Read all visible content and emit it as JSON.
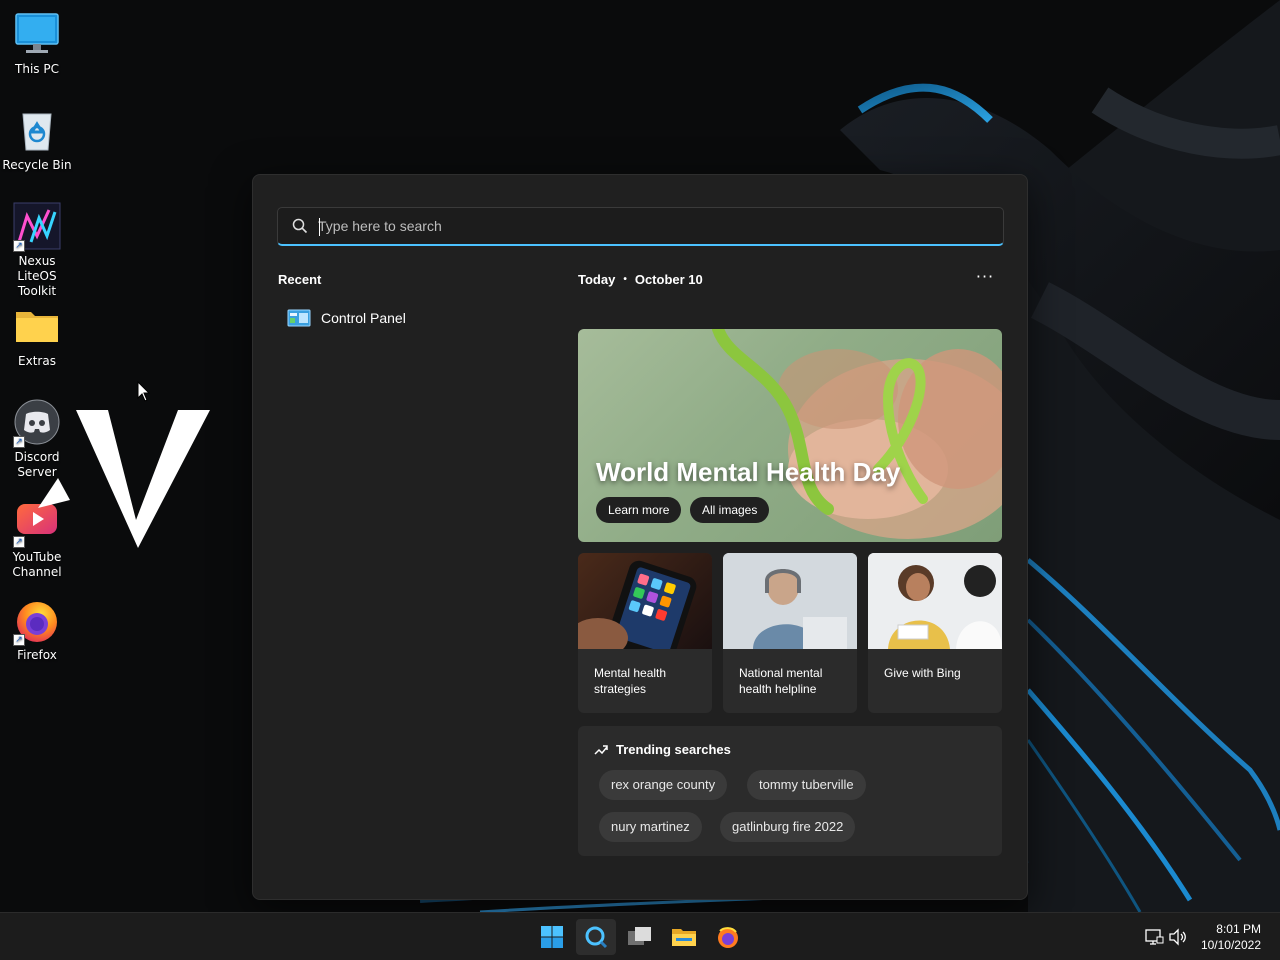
{
  "desktop": {
    "icons": [
      {
        "label": "This PC",
        "icon": "monitor-icon"
      },
      {
        "label": "Recycle Bin",
        "icon": "recycle-bin-icon"
      },
      {
        "label": "Nexus LiteOS Toolkit",
        "icon": "nexus-icon"
      },
      {
        "label": "Extras",
        "icon": "folder-icon"
      },
      {
        "label": "Discord Server",
        "icon": "discord-icon"
      },
      {
        "label": "YouTube Channel",
        "icon": "youtube-icon"
      },
      {
        "label": "Firefox",
        "icon": "firefox-icon"
      }
    ]
  },
  "search": {
    "placeholder": "Type here to search",
    "recent_header": "Recent",
    "recent_items": [
      {
        "label": "Control Panel",
        "icon": "control-panel-icon"
      }
    ],
    "today_label": "Today",
    "date_label": "October 10",
    "more_label": "···",
    "hero": {
      "title": "World Mental Health Day",
      "learn_more": "Learn more",
      "all_images": "All images"
    },
    "cards": [
      {
        "label": "Mental health strategies"
      },
      {
        "label": "National mental health helpline"
      },
      {
        "label": "Give with Bing"
      }
    ],
    "trending_title": "Trending searches",
    "trending": [
      "rex orange county",
      "tommy tuberville",
      "nury martinez",
      "gatlinburg fire 2022"
    ]
  },
  "taskbar": {
    "time": "8:01 PM",
    "date": "10/10/2022",
    "apps": [
      "start-icon",
      "search-icon",
      "task-view-icon",
      "file-explorer-icon",
      "firefox-icon"
    ]
  },
  "colors": {
    "accent": "#4cc2ff",
    "panel": "#202020",
    "card": "#2b2b2b"
  }
}
